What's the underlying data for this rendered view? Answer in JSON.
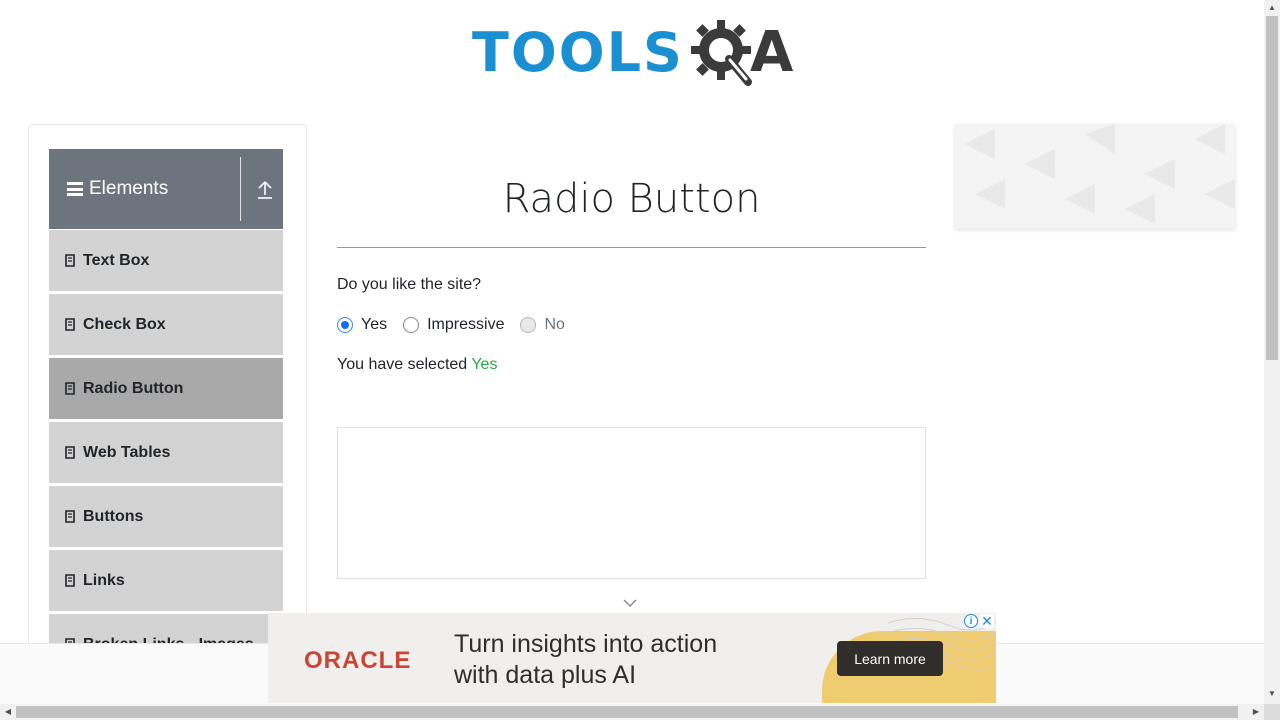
{
  "logo": {
    "word": "TOOLS",
    "letter": "A"
  },
  "sidebar": {
    "group_title": "Elements",
    "items": [
      {
        "label": "Text Box"
      },
      {
        "label": "Check Box"
      },
      {
        "label": "Radio Button"
      },
      {
        "label": "Web Tables"
      },
      {
        "label": "Buttons"
      },
      {
        "label": "Links"
      },
      {
        "label": "Broken Links - Images"
      }
    ],
    "active_index": 2
  },
  "main": {
    "title": "Radio Button",
    "question": "Do you like the site?",
    "options": [
      {
        "label": "Yes",
        "checked": true,
        "disabled": false
      },
      {
        "label": "Impressive",
        "checked": false,
        "disabled": false
      },
      {
        "label": "No",
        "checked": false,
        "disabled": true
      }
    ],
    "result_prefix": "You have selected ",
    "result_value": "Yes"
  },
  "ad": {
    "brand": "ORACLE",
    "line1": "Turn insights into action",
    "line2": "with data plus AI",
    "cta": "Learn more"
  },
  "colors": {
    "sidebar_header": "#6c757d",
    "menu_item": "#d3d3d3",
    "menu_item_active": "#a9a9a9",
    "result_value": "#28a745",
    "logo_blue": "#1a8fd1",
    "oracle_red": "#c74634"
  }
}
